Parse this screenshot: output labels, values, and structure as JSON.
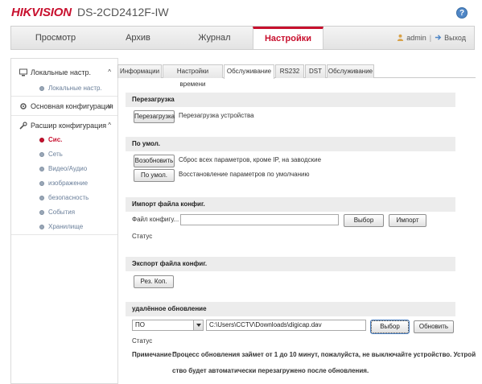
{
  "header": {
    "brand": "HIKVISION",
    "model": "DS-2CD2412F-IW"
  },
  "nav": {
    "items": [
      "Просмотр",
      "Архив",
      "Журнал",
      "Настройки"
    ],
    "user": "admin",
    "separator": "|",
    "logout": "Выход"
  },
  "sidebar": {
    "local": "Локальные настр.",
    "local_sub": "Локальные настр.",
    "basic": "Основная конфигурация",
    "advanced": "Расшир конфигурация",
    "advanced_items": [
      "Сис.",
      "Сеть",
      "Видео/Аудио",
      "изображение",
      "безопасность",
      "События",
      "Хранилище"
    ]
  },
  "tabs": [
    "Информации",
    "Настройки времени",
    "Обслуживание",
    "RS232",
    "DST",
    "Обслуживание"
  ],
  "reboot": {
    "title": "Перезагрузка",
    "button": "Перезагрузка",
    "desc": "Перезагрузка устройства"
  },
  "defaults": {
    "title": "По умол.",
    "restore_button": "Возобновить",
    "restore_desc": "Сброс всех параметров, кроме IP, на заводские",
    "default_button": "По умол.",
    "default_desc": "Восстановление параметров по умолчанию"
  },
  "import": {
    "title": "Импорт файла конфиг.",
    "file_label": "Файл конфигу...",
    "file_value": "",
    "browse_button": "Выбор",
    "import_button": "Импорт",
    "status_label": "Статус"
  },
  "export": {
    "title": "Экспорт файла конфиг.",
    "backup_button": "Рез. Коп."
  },
  "upgrade": {
    "title": "удалённое обновление",
    "select_value": "ПО",
    "path_value": "C:\\Users\\CCTV\\Downloads\\digicap.dav",
    "browse_button": "Выбор",
    "update_button": "Обновить",
    "status_label": "Статус",
    "note_label": "Примечание :",
    "note_line1": "Процесс обновления займет от 1 до 10 минут, пожалуйста, не выключайте устройство. Устрой",
    "note_line2": "ство будет автоматически перезагружено после обновления."
  },
  "colors": {
    "brand_red": "#c8102e",
    "help_blue": "#4f86c6"
  }
}
